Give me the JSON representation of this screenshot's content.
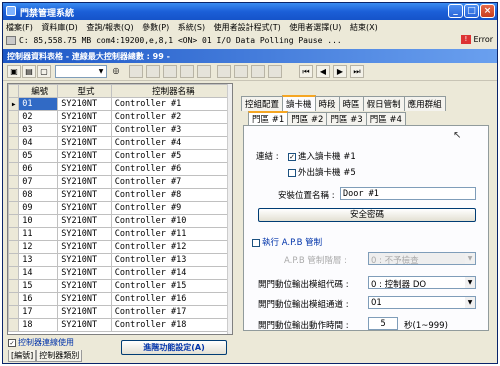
{
  "window": {
    "title": "門禁管理系統",
    "buttons": [
      "_",
      "□",
      "×"
    ]
  },
  "menu": [
    "檔案(F)",
    "資料庫(D)",
    "查詢/報表(Q)",
    "參數(P)",
    "系統(S)",
    "使用者設計程式(T)",
    "使用者選擇(U)",
    "結束(X)"
  ],
  "status": {
    "text": "C: 85,558.75 MB  com4:19200,e,8,1 <ON>  01  I/O Data Polling Pause ...",
    "error_label": "Error"
  },
  "breadcrumb": "控制器資料表格 - 連線最大控制器總數 : 99 -",
  "toolbar": {
    "combo_value": "",
    "find_icon": "binoculars-icon"
  },
  "grid": {
    "headers": [
      "編號",
      "型式",
      "控制器名稱"
    ],
    "rows": [
      [
        "01",
        "SY210NT",
        "Controller #1"
      ],
      [
        "02",
        "SY210NT",
        "Controller #2"
      ],
      [
        "03",
        "SY210NT",
        "Controller #3"
      ],
      [
        "04",
        "SY210NT",
        "Controller #4"
      ],
      [
        "05",
        "SY210NT",
        "Controller #5"
      ],
      [
        "06",
        "SY210NT",
        "Controller #6"
      ],
      [
        "07",
        "SY210NT",
        "Controller #7"
      ],
      [
        "08",
        "SY210NT",
        "Controller #8"
      ],
      [
        "09",
        "SY210NT",
        "Controller #9"
      ],
      [
        "10",
        "SY210NT",
        "Controller #10"
      ],
      [
        "11",
        "SY210NT",
        "Controller #11"
      ],
      [
        "12",
        "SY210NT",
        "Controller #12"
      ],
      [
        "13",
        "SY210NT",
        "Controller #13"
      ],
      [
        "14",
        "SY210NT",
        "Controller #14"
      ],
      [
        "15",
        "SY210NT",
        "Controller #15"
      ],
      [
        "16",
        "SY210NT",
        "Controller #16"
      ],
      [
        "17",
        "SY210NT",
        "Controller #17"
      ],
      [
        "18",
        "SY210NT",
        "Controller #18"
      ]
    ],
    "selected_row": 0
  },
  "bottom_left": {
    "checkbox_label": "控制器連線使用",
    "tabs": [
      "[編號]",
      "控制器類別"
    ],
    "advanced_button": "進階功能設定(A)"
  },
  "right": {
    "tabs": [
      "控組配置",
      "讀卡機",
      "時段",
      "時區",
      "假日管制",
      "應用群組"
    ],
    "active_tab": 1,
    "subtabs": [
      "門區 #1",
      "門區 #2",
      "門區 #3",
      "門區 #4"
    ],
    "active_subtab": 0,
    "connect_label": "連結 :",
    "reader_in": "進入讀卡機 #1",
    "reader_out": "外出讀卡機 #5",
    "location_label": "安裝位置名稱 :",
    "location_value": "Door #1",
    "security_button": "安全密碼",
    "apb_label": "執行 A.P.B 管制",
    "apb_level_label": "A.P.B 管制階層 :",
    "apb_level_value": "0 : 不予檢查",
    "output_group_label": "開門動位輸出模組代碼 :",
    "output_group_value": "0 : 控制器 DO",
    "output_channel_label": "開門動位輸出模組通道 :",
    "output_channel_value": "01",
    "output_time_label": "開門動位輸出動作時間 :",
    "output_time_value": "5",
    "output_time_unit": "秒(1~999)"
  }
}
